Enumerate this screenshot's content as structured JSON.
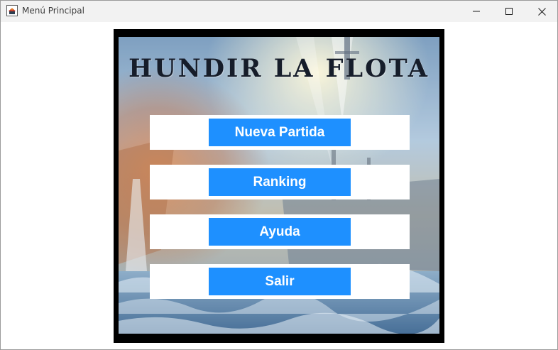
{
  "window": {
    "title": "Menú Principal",
    "icon": "java-cup-icon",
    "controls": {
      "minimize": "minimize-icon",
      "maximize": "maximize-icon",
      "close": "close-icon"
    }
  },
  "menu": {
    "title": "HUNDIR LA FLOTA",
    "buttons": {
      "new_game": "Nueva Partida",
      "ranking": "Ranking",
      "help": "Ayuda",
      "exit": "Salir"
    }
  },
  "colors": {
    "button_background": "#1e90ff",
    "button_text": "#ffffff",
    "frame_border": "#000000",
    "title_text": "#161d2a",
    "titlebar": "#f2f2f2"
  }
}
